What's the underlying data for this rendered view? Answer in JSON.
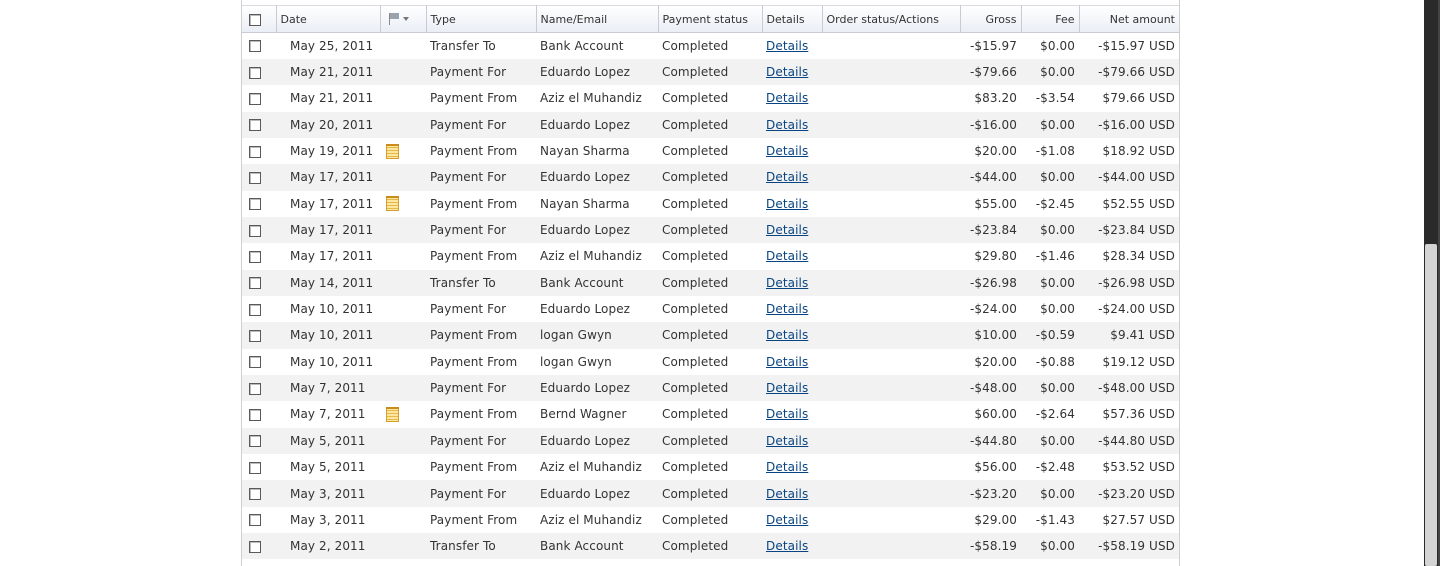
{
  "columns": {
    "date": "Date",
    "type": "Type",
    "name": "Name/Email",
    "status": "Payment status",
    "details": "Details",
    "order": "Order status/Actions",
    "gross": "Gross",
    "fee": "Fee",
    "net": "Net amount"
  },
  "icons": {
    "flag_column": "flag-icon",
    "note": "note-icon",
    "checkbox": "checkbox-icon"
  },
  "colors": {
    "link": "#084482",
    "row_alt": "#f2f2f2",
    "note": "#fde7a0"
  },
  "rows": [
    {
      "date": "May 25, 2011",
      "note": false,
      "type": "Transfer To",
      "name": "Bank Account",
      "status": "Completed",
      "details": "Details",
      "gross": "-$15.97",
      "fee": "$0.00",
      "net": "-$15.97 USD"
    },
    {
      "date": "May 21, 2011",
      "note": false,
      "type": "Payment For",
      "name": "Eduardo Lopez",
      "status": "Completed",
      "details": "Details",
      "gross": "-$79.66",
      "fee": "$0.00",
      "net": "-$79.66 USD"
    },
    {
      "date": "May 21, 2011",
      "note": false,
      "type": "Payment From",
      "name": "Aziz el Muhandiz",
      "status": "Completed",
      "details": "Details",
      "gross": "$83.20",
      "fee": "-$3.54",
      "net": "$79.66 USD"
    },
    {
      "date": "May 20, 2011",
      "note": false,
      "type": "Payment For",
      "name": "Eduardo Lopez",
      "status": "Completed",
      "details": "Details",
      "gross": "-$16.00",
      "fee": "$0.00",
      "net": "-$16.00 USD"
    },
    {
      "date": "May 19, 2011",
      "note": true,
      "type": "Payment From",
      "name": "Nayan Sharma",
      "status": "Completed",
      "details": "Details",
      "gross": "$20.00",
      "fee": "-$1.08",
      "net": "$18.92 USD"
    },
    {
      "date": "May 17, 2011",
      "note": false,
      "type": "Payment For",
      "name": "Eduardo Lopez",
      "status": "Completed",
      "details": "Details",
      "gross": "-$44.00",
      "fee": "$0.00",
      "net": "-$44.00 USD"
    },
    {
      "date": "May 17, 2011",
      "note": true,
      "type": "Payment From",
      "name": "Nayan Sharma",
      "status": "Completed",
      "details": "Details",
      "gross": "$55.00",
      "fee": "-$2.45",
      "net": "$52.55 USD"
    },
    {
      "date": "May 17, 2011",
      "note": false,
      "type": "Payment For",
      "name": "Eduardo Lopez",
      "status": "Completed",
      "details": "Details",
      "gross": "-$23.84",
      "fee": "$0.00",
      "net": "-$23.84 USD"
    },
    {
      "date": "May 17, 2011",
      "note": false,
      "type": "Payment From",
      "name": "Aziz el Muhandiz",
      "status": "Completed",
      "details": "Details",
      "gross": "$29.80",
      "fee": "-$1.46",
      "net": "$28.34 USD"
    },
    {
      "date": "May 14, 2011",
      "note": false,
      "type": "Transfer To",
      "name": "Bank Account",
      "status": "Completed",
      "details": "Details",
      "gross": "-$26.98",
      "fee": "$0.00",
      "net": "-$26.98 USD"
    },
    {
      "date": "May 10, 2011",
      "note": false,
      "type": "Payment For",
      "name": "Eduardo Lopez",
      "status": "Completed",
      "details": "Details",
      "gross": "-$24.00",
      "fee": "$0.00",
      "net": "-$24.00 USD"
    },
    {
      "date": "May 10, 2011",
      "note": false,
      "type": "Payment From",
      "name": "logan Gwyn",
      "status": "Completed",
      "details": "Details",
      "gross": "$10.00",
      "fee": "-$0.59",
      "net": "$9.41 USD"
    },
    {
      "date": "May 10, 2011",
      "note": false,
      "type": "Payment From",
      "name": "logan Gwyn",
      "status": "Completed",
      "details": "Details",
      "gross": "$20.00",
      "fee": "-$0.88",
      "net": "$19.12 USD"
    },
    {
      "date": "May 7, 2011",
      "note": false,
      "type": "Payment For",
      "name": "Eduardo Lopez",
      "status": "Completed",
      "details": "Details",
      "gross": "-$48.00",
      "fee": "$0.00",
      "net": "-$48.00 USD"
    },
    {
      "date": "May 7, 2011",
      "note": true,
      "type": "Payment From",
      "name": "Bernd Wagner",
      "status": "Completed",
      "details": "Details",
      "gross": "$60.00",
      "fee": "-$2.64",
      "net": "$57.36 USD"
    },
    {
      "date": "May 5, 2011",
      "note": false,
      "type": "Payment For",
      "name": "Eduardo Lopez",
      "status": "Completed",
      "details": "Details",
      "gross": "-$44.80",
      "fee": "$0.00",
      "net": "-$44.80 USD"
    },
    {
      "date": "May 5, 2011",
      "note": false,
      "type": "Payment From",
      "name": "Aziz el Muhandiz",
      "status": "Completed",
      "details": "Details",
      "gross": "$56.00",
      "fee": "-$2.48",
      "net": "$53.52 USD"
    },
    {
      "date": "May 3, 2011",
      "note": false,
      "type": "Payment For",
      "name": "Eduardo Lopez",
      "status": "Completed",
      "details": "Details",
      "gross": "-$23.20",
      "fee": "$0.00",
      "net": "-$23.20 USD"
    },
    {
      "date": "May 3, 2011",
      "note": false,
      "type": "Payment From",
      "name": "Aziz el Muhandiz",
      "status": "Completed",
      "details": "Details",
      "gross": "$29.00",
      "fee": "-$1.43",
      "net": "$27.57 USD"
    },
    {
      "date": "May 2, 2011",
      "note": false,
      "type": "Transfer To",
      "name": "Bank Account",
      "status": "Completed",
      "details": "Details",
      "gross": "-$58.19",
      "fee": "$0.00",
      "net": "-$58.19 USD"
    }
  ]
}
